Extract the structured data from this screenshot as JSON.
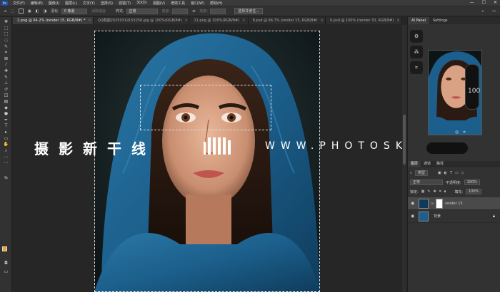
{
  "menubar": {
    "logo": "Ps",
    "items": [
      "文件(F)",
      "编辑(E)",
      "图像(I)",
      "图层(L)",
      "文字(Y)",
      "选择(S)",
      "滤镜(T)",
      "3D(D)",
      "视图(V)",
      "增效工具",
      "窗口(W)",
      "帮助(H)"
    ],
    "window_controls": [
      "—",
      "☐",
      "✕"
    ]
  },
  "options": {
    "feather_label": "羽化:",
    "feather_value": "0 像素",
    "antialias": "消除锯齿",
    "style_label": "样式:",
    "style_value": "正常",
    "width_label": "宽度:",
    "height_label": "高度:",
    "select_mask": "选择并遮住..."
  },
  "tabs": [
    {
      "label": "2.png @ 64.2% (render 15, RGB/8#) *",
      "active": true
    },
    {
      "label": "QQ截图20250319153256.jpg @ 100%(RGB/8#)",
      "active": false
    },
    {
      "label": "11.png @ 100%(RGB/8#)",
      "active": false
    },
    {
      "label": "8.psd @ 66.7% (render 15, RGB/8#)",
      "active": false
    },
    {
      "label": "6.psd @ 100% (render 70, RGB/8#)",
      "active": false
    }
  ],
  "watermark": {
    "left": "摄影新干线",
    "right": "WWW.PHOTOSKS.VIP"
  },
  "right_panel": {
    "tabs": [
      "AI Panel",
      "Settings"
    ],
    "slider_value": "100"
  },
  "layers_panel": {
    "tabs": [
      "图层",
      "通道",
      "路径"
    ],
    "kind_label": "类型",
    "blend_mode": "正常",
    "opacity_label": "不透明度:",
    "opacity_value": "100%",
    "lock_label": "锁定:",
    "fill_label": "填充:",
    "fill_value": "100%",
    "layers": [
      {
        "name": "render 15",
        "active": true
      },
      {
        "name": "背景",
        "active": false
      }
    ]
  },
  "colors": {
    "foreground": "#f3a21a",
    "background": "#ffffff",
    "accent": "#1f4ea3"
  }
}
